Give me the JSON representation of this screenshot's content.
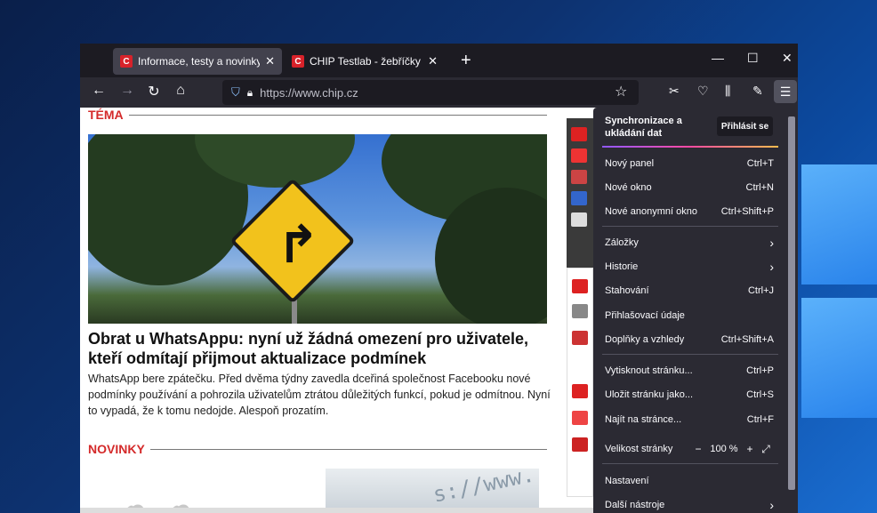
{
  "tabs": [
    {
      "favicon": "C",
      "title": "Informace, testy a novinky o ha",
      "close": "✕",
      "active": true
    },
    {
      "favicon": "C",
      "title": "CHIP Testlab - žebříčky & testy",
      "close": "✕",
      "active": false
    }
  ],
  "new_tab": "+",
  "window_controls": {
    "minimize": "—",
    "maximize": "☐",
    "close": "✕"
  },
  "nav": {
    "back": "←",
    "forward": "→",
    "reload": "↻",
    "home": "⌂"
  },
  "url": "https://www.chip.cz",
  "toolbar_icons": [
    "screenshot-icon",
    "pocket-icon",
    "library-icon",
    "extension-icon",
    "menu-icon"
  ],
  "page": {
    "section1": "TÉMA",
    "article_title": "Obrat u WhatsAppu: nyní už žádná omezení pro uživatele, kteří odmítají přijmout aktualizace podmínek",
    "article_text": "WhatsApp bere zpátečku. Před dvěma týdny zavedla dceřiná společnost Facebooku nové podmínky používání a pohrozila uživatelům ztrátou důležitých funkcí, pokud je odmítnou. Nyní to vypadá, že k tomu nedojde. Alespoň prozatím.",
    "section2": "NOVINKY",
    "thumb_text": "s://www."
  },
  "menu": {
    "sync_title": "Synchronizace a ukládání dat",
    "sync_button": "Přihlásit se",
    "items": [
      {
        "label": "Nový panel",
        "shortcut": "Ctrl+T"
      },
      {
        "label": "Nové okno",
        "shortcut": "Ctrl+N"
      },
      {
        "label": "Nové anonymní okno",
        "shortcut": "Ctrl+Shift+P"
      },
      {
        "label": "Záložky",
        "shortcut": "›"
      },
      {
        "label": "Historie",
        "shortcut": "›"
      },
      {
        "label": "Stahování",
        "shortcut": "Ctrl+J"
      },
      {
        "label": "Přihlašovací údaje",
        "shortcut": ""
      },
      {
        "label": "Doplňky a vzhledy",
        "shortcut": "Ctrl+Shift+A"
      },
      {
        "label": "Vytisknout stránku...",
        "shortcut": "Ctrl+P"
      },
      {
        "label": "Uložit stránku jako...",
        "shortcut": "Ctrl+S"
      },
      {
        "label": "Najít na stránce...",
        "shortcut": "Ctrl+F"
      },
      {
        "label": "Nastavení",
        "shortcut": ""
      },
      {
        "label": "Další nástroje",
        "shortcut": "›"
      }
    ],
    "zoom": {
      "label": "Velikost stránky",
      "minus": "−",
      "value": "100 %",
      "plus": "+",
      "fullscreen": "⤢"
    }
  }
}
